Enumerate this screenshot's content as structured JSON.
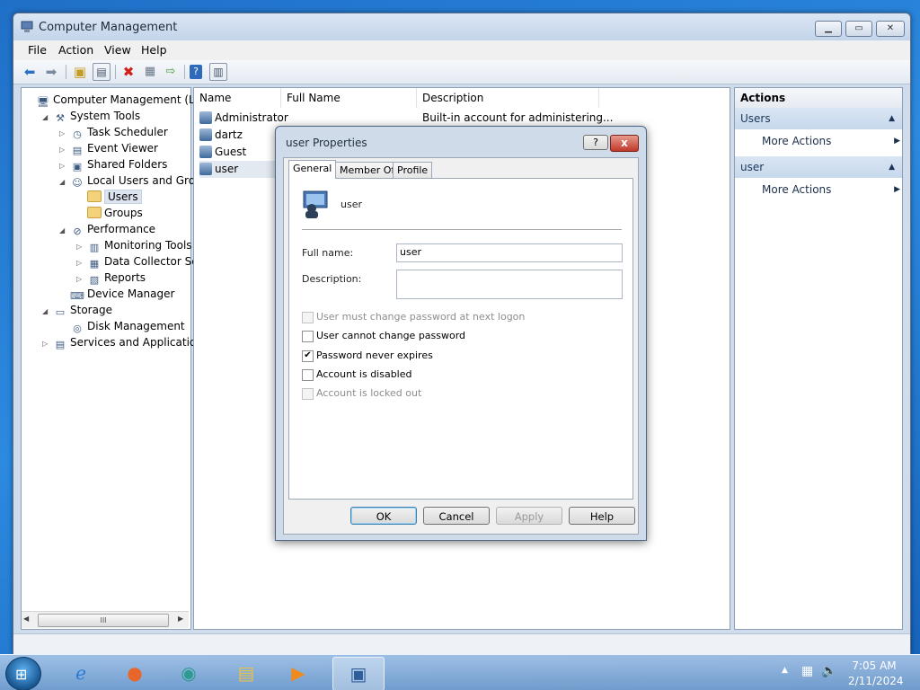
{
  "window": {
    "title": "Computer Management"
  },
  "menu": [
    "File",
    "Action",
    "View",
    "Help"
  ],
  "toolbar": [
    "back-icon",
    "forward-icon",
    "up-folder-icon",
    "show-hide-tree-icon",
    "delete-icon",
    "properties-icon",
    "export-icon",
    "help-icon",
    "console-icon"
  ],
  "tree": {
    "items": [
      {
        "label": "Computer Management (Local",
        "icon": "computer-icon",
        "level": 0,
        "twisty": ""
      },
      {
        "label": "System Tools",
        "icon": "tools-icon",
        "level": 1,
        "twisty": "open"
      },
      {
        "label": "Task Scheduler",
        "icon": "clock-icon",
        "level": 2,
        "twisty": "closed"
      },
      {
        "label": "Event Viewer",
        "icon": "event-viewer-icon",
        "level": 2,
        "twisty": "closed"
      },
      {
        "label": "Shared Folders",
        "icon": "shared-folder-icon",
        "level": 2,
        "twisty": "closed"
      },
      {
        "label": "Local Users and Groups",
        "icon": "users-groups-icon",
        "level": 2,
        "twisty": "open"
      },
      {
        "label": "Users",
        "icon": "folder-icon",
        "level": 3,
        "twisty": "",
        "selected": true
      },
      {
        "label": "Groups",
        "icon": "folder-icon",
        "level": 3,
        "twisty": ""
      },
      {
        "label": "Performance",
        "icon": "performance-icon",
        "level": 2,
        "twisty": "open"
      },
      {
        "label": "Monitoring Tools",
        "icon": "monitoring-icon",
        "level": 3,
        "twisty": "closed"
      },
      {
        "label": "Data Collector Sets",
        "icon": "data-collector-icon",
        "level": 3,
        "twisty": "closed"
      },
      {
        "label": "Reports",
        "icon": "reports-icon",
        "level": 3,
        "twisty": "closed"
      },
      {
        "label": "Device Manager",
        "icon": "device-manager-icon",
        "level": 2,
        "twisty": ""
      },
      {
        "label": "Storage",
        "icon": "storage-icon",
        "level": 1,
        "twisty": "open"
      },
      {
        "label": "Disk Management",
        "icon": "disk-icon",
        "level": 2,
        "twisty": ""
      },
      {
        "label": "Services and Applications",
        "icon": "services-icon",
        "level": 1,
        "twisty": "closed"
      }
    ],
    "scroll_grip": "III"
  },
  "list": {
    "columns": [
      "Name",
      "Full Name",
      "Description"
    ],
    "rows": [
      {
        "name": "Administrator",
        "full_name": "",
        "description": "Built-in account for administering..."
      },
      {
        "name": "dartz",
        "full_name": "",
        "description": ""
      },
      {
        "name": "Guest",
        "full_name": "",
        "description": ""
      },
      {
        "name": "user",
        "full_name": "",
        "description": "",
        "selected": true
      }
    ]
  },
  "actions": {
    "title": "Actions",
    "sections": [
      {
        "title": "Users",
        "item": "More Actions"
      },
      {
        "title": "user",
        "item": "More Actions"
      }
    ]
  },
  "dialog": {
    "title": "user Properties",
    "help_btn": "?",
    "close_btn": "x",
    "tabs": [
      "General",
      "Member Of",
      "Profile"
    ],
    "active_tab": "General",
    "username": "user",
    "full_name_label": "Full name:",
    "full_name_value": "user",
    "description_label": "Description:",
    "description_value": "",
    "checkboxes": [
      {
        "label": "User must change password at next logon",
        "checked": false,
        "disabled": true
      },
      {
        "label": "User cannot change password",
        "checked": false,
        "disabled": false
      },
      {
        "label": "Password never expires",
        "checked": true,
        "disabled": false
      },
      {
        "label": "Account is disabled",
        "checked": false,
        "disabled": false
      },
      {
        "label": "Account is locked out",
        "checked": false,
        "disabled": true
      }
    ],
    "buttons": {
      "ok": "OK",
      "cancel": "Cancel",
      "apply": "Apply",
      "help": "Help"
    }
  },
  "taskbar": {
    "apps": [
      "internet-explorer-icon",
      "firefox-icon",
      "edge-icon",
      "file-explorer-icon",
      "media-player-icon",
      "computer-management-icon"
    ],
    "time": "7:05 AM",
    "date": "2/11/2024"
  }
}
